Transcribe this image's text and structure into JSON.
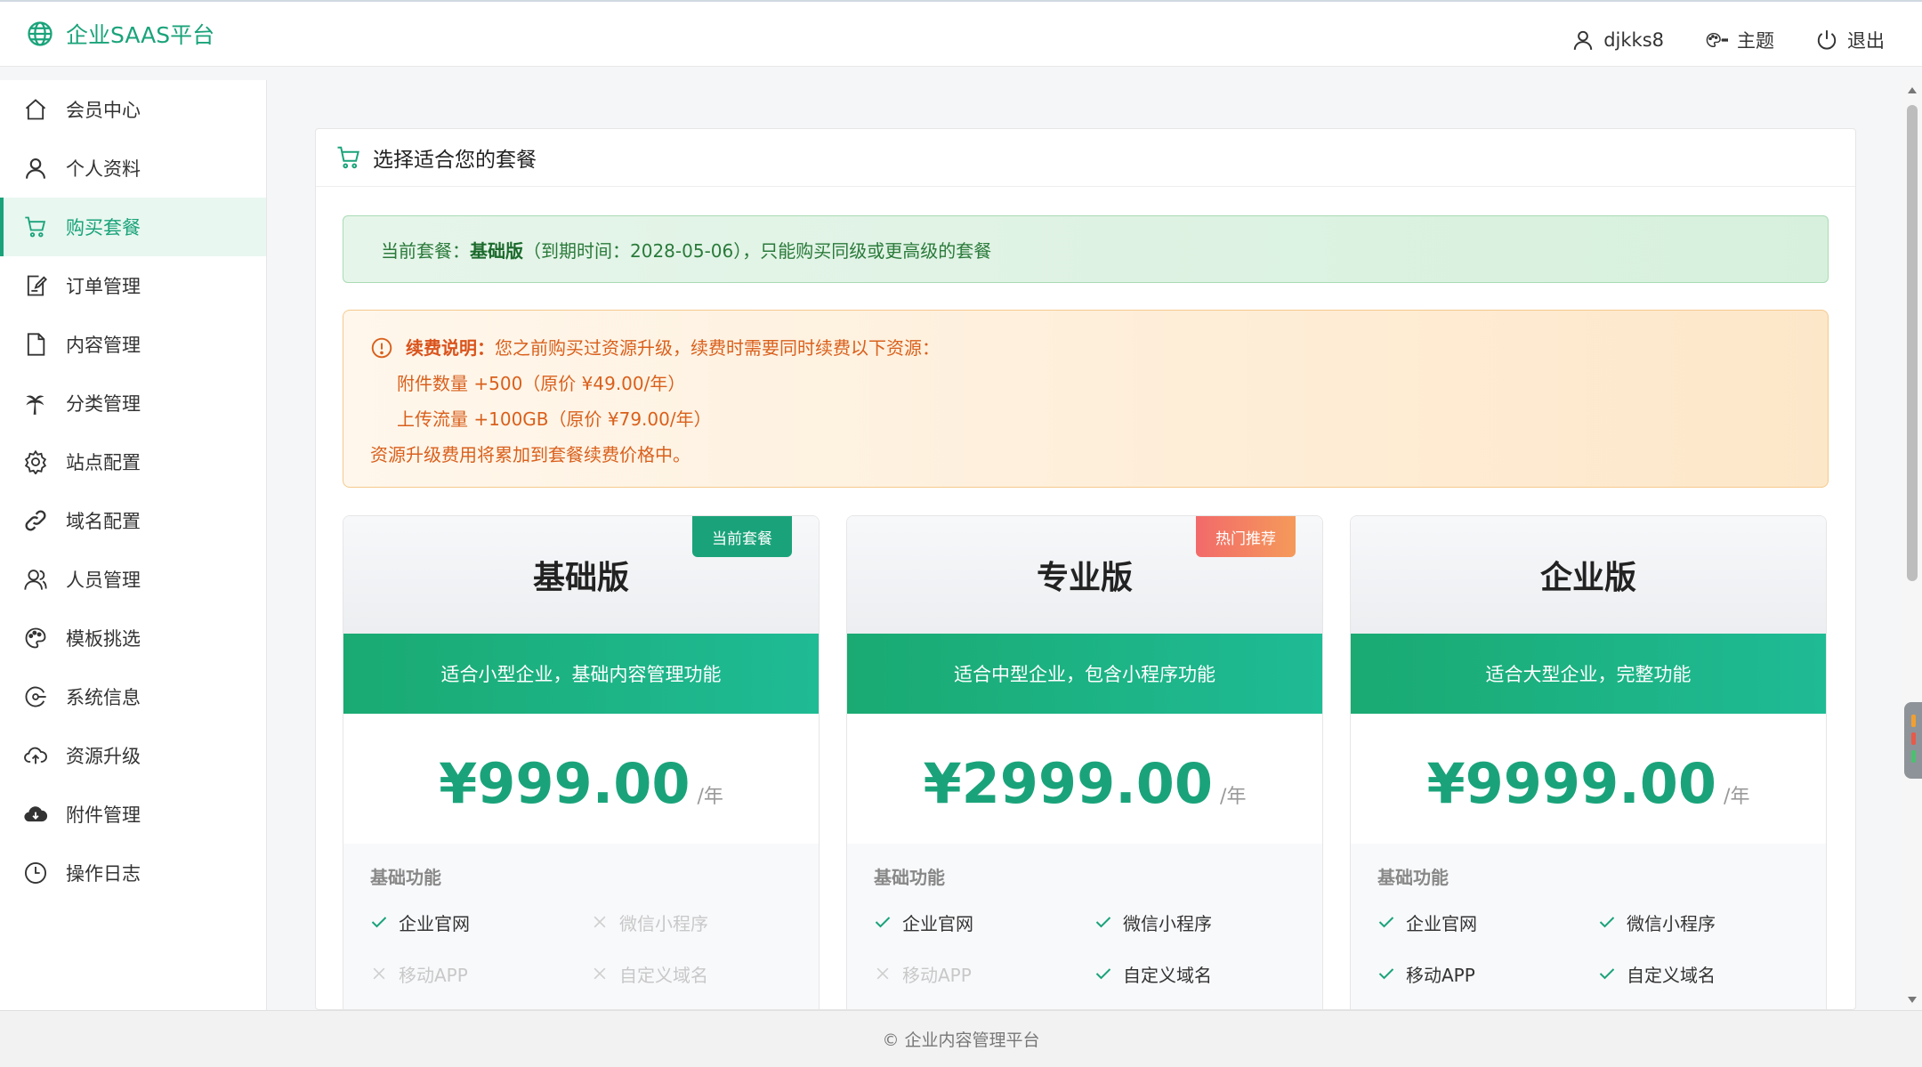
{
  "header": {
    "brand": "企业SAAS平台",
    "user": "djkks8",
    "theme": "主题",
    "logout": "退出"
  },
  "sidebar": {
    "items": [
      {
        "label": "会员中心",
        "icon": "home-icon"
      },
      {
        "label": "个人资料",
        "icon": "user-icon"
      },
      {
        "label": "购买套餐",
        "icon": "cart-icon",
        "active": true
      },
      {
        "label": "订单管理",
        "icon": "edit-doc-icon"
      },
      {
        "label": "内容管理",
        "icon": "document-icon"
      },
      {
        "label": "分类管理",
        "icon": "palm-icon"
      },
      {
        "label": "站点配置",
        "icon": "gear-icon"
      },
      {
        "label": "域名配置",
        "icon": "link-icon"
      },
      {
        "label": "人员管理",
        "icon": "users-icon"
      },
      {
        "label": "模板挑选",
        "icon": "palette-icon"
      },
      {
        "label": "系统信息",
        "icon": "info-circle-icon"
      },
      {
        "label": "资源升级",
        "icon": "cloud-upload-icon"
      },
      {
        "label": "附件管理",
        "icon": "cloud-icon"
      },
      {
        "label": "操作日志",
        "icon": "clock-icon"
      }
    ]
  },
  "panel": {
    "title": "选择适合您的套餐",
    "current_prefix": "当前套餐：",
    "current_plan": "基础版",
    "current_suffix": "（到期时间：2028-05-06），只能购买同级或更高级的套餐",
    "renew_title": "续费说明：",
    "renew_text": "您之前购买过资源升级，续费时需要同时续费以下资源：",
    "renew_item1": "附件数量 +500（原价 ¥49.00/年）",
    "renew_item2": "上传流量 +100GB（原价 ¥79.00/年）",
    "renew_note": "资源升级费用将累加到套餐续费价格中。"
  },
  "plans": [
    {
      "name": "基础版",
      "badge": "当前套餐",
      "desc": "适合小型企业，基础内容管理功能",
      "price": "¥999.00",
      "per": "/年",
      "feature_title": "基础功能",
      "features": [
        {
          "label": "企业官网",
          "on": true
        },
        {
          "label": "微信小程序",
          "on": false
        },
        {
          "label": "移动APP",
          "on": false
        },
        {
          "label": "自定义域名",
          "on": false
        }
      ]
    },
    {
      "name": "专业版",
      "badge": "热门推荐",
      "desc": "适合中型企业，包含小程序功能",
      "price": "¥2999.00",
      "per": "/年",
      "feature_title": "基础功能",
      "features": [
        {
          "label": "企业官网",
          "on": true
        },
        {
          "label": "微信小程序",
          "on": true
        },
        {
          "label": "移动APP",
          "on": false
        },
        {
          "label": "自定义域名",
          "on": true
        }
      ]
    },
    {
      "name": "企业版",
      "badge": "",
      "desc": "适合大型企业，完整功能",
      "price": "¥9999.00",
      "per": "/年",
      "feature_title": "基础功能",
      "features": [
        {
          "label": "企业官网",
          "on": true
        },
        {
          "label": "微信小程序",
          "on": true
        },
        {
          "label": "移动APP",
          "on": true
        },
        {
          "label": "自定义域名",
          "on": true
        }
      ]
    }
  ],
  "footer": "© 企业内容管理平台",
  "colors": {
    "accent": "#1aa37a",
    "warn": "#d9601c"
  }
}
